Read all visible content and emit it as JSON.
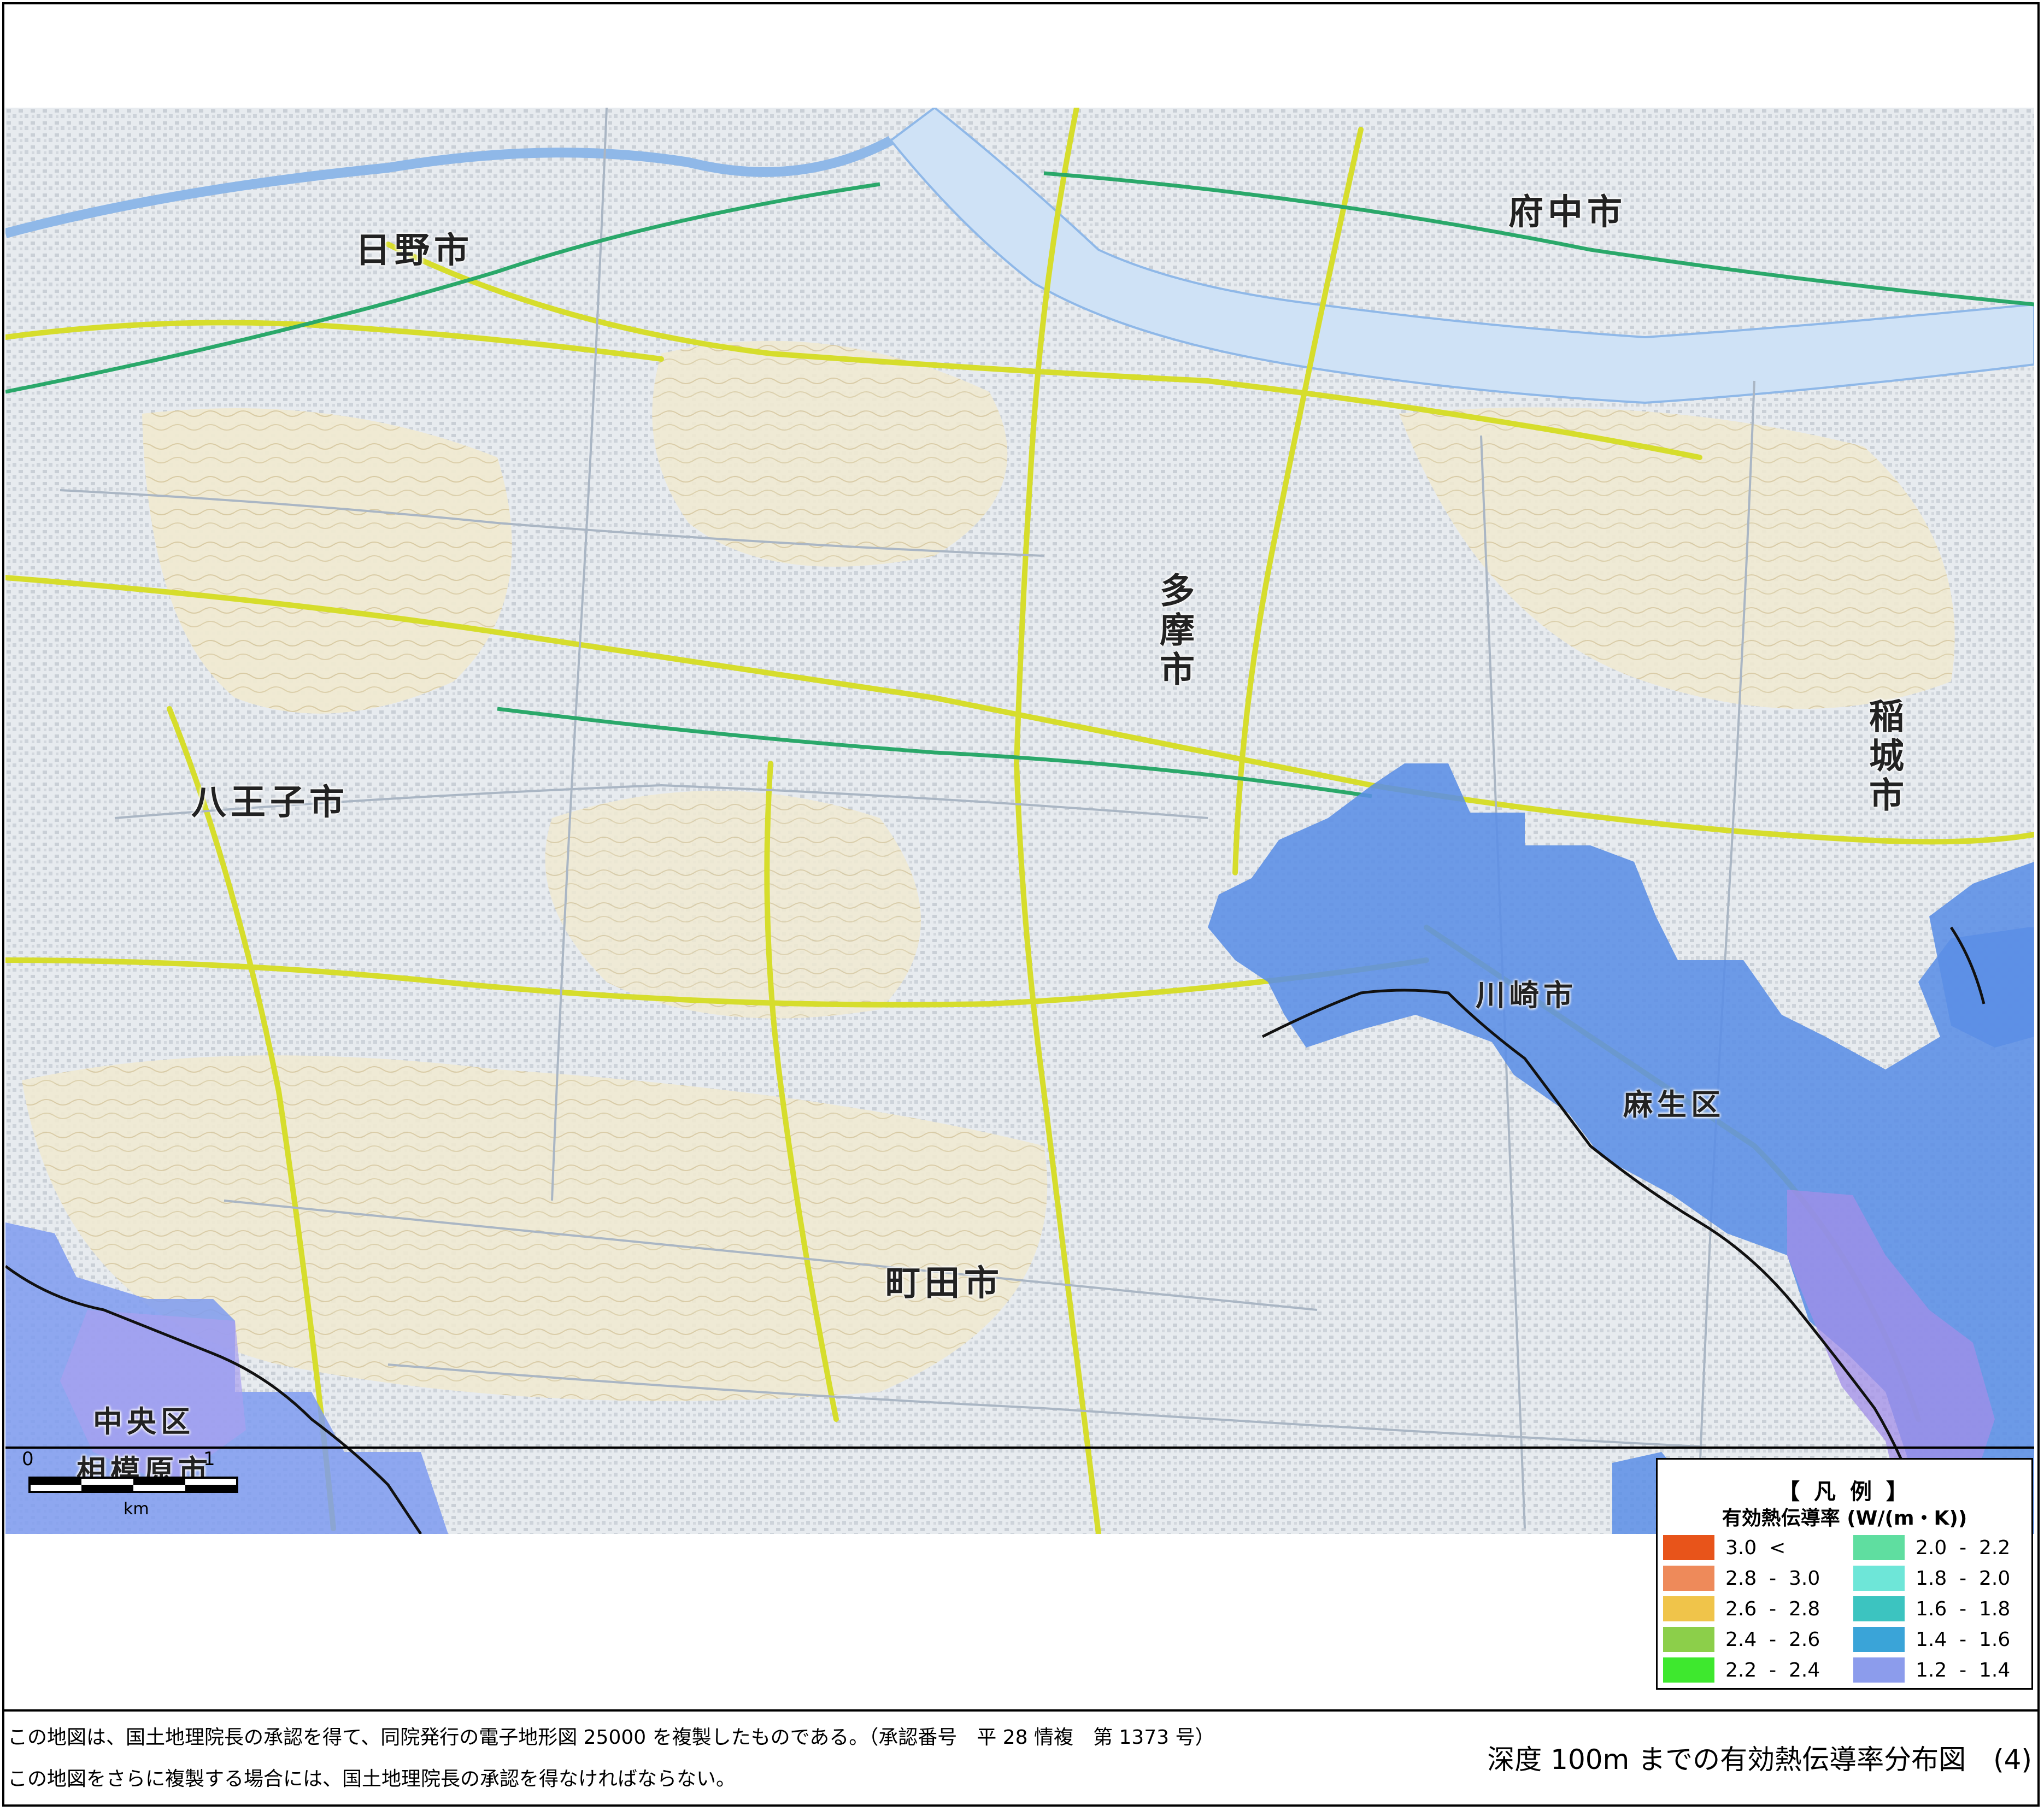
{
  "map": {
    "places": {
      "hino": "日野市",
      "fuchu": "府中市",
      "tama": "多摩市",
      "hachioji": "八王子市",
      "inagi": "稲城市",
      "kawasaki": "川崎市",
      "asao": "麻生区",
      "machida": "町田市",
      "chuo": "中央区",
      "sagamihara": "相模原市"
    },
    "colors": {
      "background": "#e9ecef",
      "hill": "#f1ebd0",
      "road_major": "#d6dd2c",
      "road_minor": "#a8b8c8",
      "river": "#8fb8e8",
      "railway": "#2aa86a",
      "overlay_blue": "#5b8ee6"
    },
    "scale": {
      "zero": "0",
      "one": "1",
      "unit": "km"
    }
  },
  "legend": {
    "title": "【 凡 例 】",
    "subtitle": "有効熱伝導率 (W/(m・K))",
    "items": [
      {
        "label": "3.0  <",
        "color": "#e8541a"
      },
      {
        "label": "2.8  -  3.0",
        "color": "#ee8a5a"
      },
      {
        "label": "2.6  -  2.8",
        "color": "#f0c44a"
      },
      {
        "label": "2.4  -  2.6",
        "color": "#8ccf4a"
      },
      {
        "label": "2.2  -  2.4",
        "color": "#3ee82e"
      },
      {
        "label": "2.0  -  2.2",
        "color": "#5fdea0"
      },
      {
        "label": "1.8  -  2.0",
        "color": "#6ee6d8"
      },
      {
        "label": "1.6  -  1.8",
        "color": "#3cc4c0"
      },
      {
        "label": "1.4  -  1.6",
        "color": "#3aa4d8"
      },
      {
        "label": "1.2  -  1.4",
        "color": "#8c9cec"
      }
    ]
  },
  "footer": {
    "note1": "この地図は、国土地理院長の承認を得て、同院発行の電子地形図 25000 を複製したものである。（承認番号　平 28 情複　第 1373 号）",
    "note2": "この地図をさらに複製する場合には、国土地理院長の承認を得なければならない。",
    "title": "深度 100m までの有効熱伝導率分布図　(4)"
  }
}
